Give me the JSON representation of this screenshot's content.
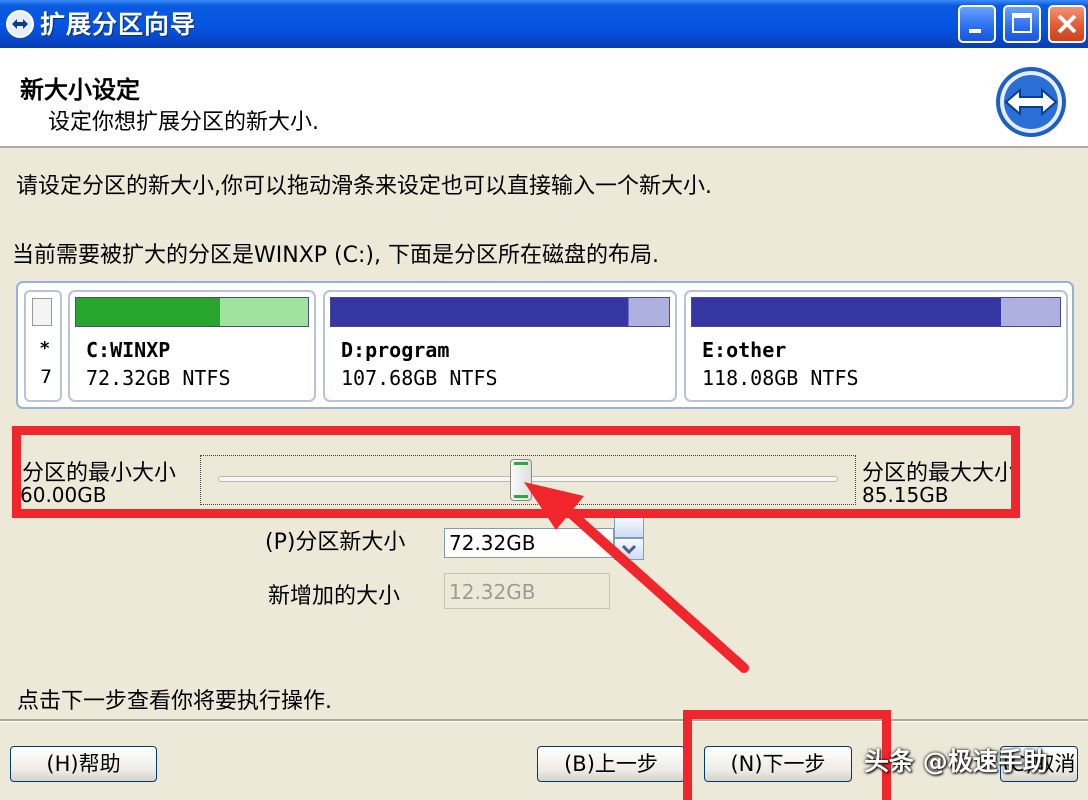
{
  "window": {
    "title": "扩展分区向导"
  },
  "header": {
    "title": "新大小设定",
    "subtitle": "设定你想扩展分区的新大小."
  },
  "instructions": {
    "line1": "请设定分区的新大小,你可以拖动滑条来设定也可以直接输入一个新大小.",
    "line2": "当前需要被扩大的分区是WINXP (C:), 下面是分区所在磁盘的布局."
  },
  "disk": {
    "marker": "*",
    "number": "7",
    "partitions": [
      {
        "name": "C:WINXP",
        "info": "72.32GB NTFS",
        "used_fraction": 0.62,
        "color": "#27a52c",
        "free_color": "#9fe39f"
      },
      {
        "name": "D:program",
        "info": "107.68GB NTFS",
        "used_fraction": 0.88,
        "color": "#3636a3",
        "free_color": "#aeb1e0"
      },
      {
        "name": "E:other",
        "info": "118.08GB NTFS",
        "used_fraction": 0.84,
        "color": "#3636a3",
        "free_color": "#aeb1e0"
      }
    ]
  },
  "slider": {
    "min_label": "分区的最小大小",
    "min_value": "60.00GB",
    "max_label": "分区的最大大小",
    "max_value": "85.15GB",
    "position_fraction": 0.488
  },
  "fields": {
    "new_size_label": "(P)分区新大小",
    "new_size_value": "72.32GB",
    "added_label": "新增加的大小",
    "added_value": "12.32GB"
  },
  "hint": "点击下一步查看你将要执行操作.",
  "buttons": {
    "help": "(H)帮助",
    "back": "(B)上一步",
    "next": "(N)下一步",
    "cancel": "(C)取消"
  },
  "watermark": "头条 @极速手助",
  "colors": {
    "highlight": "#f0262c",
    "titlebar": "#0554e3"
  }
}
